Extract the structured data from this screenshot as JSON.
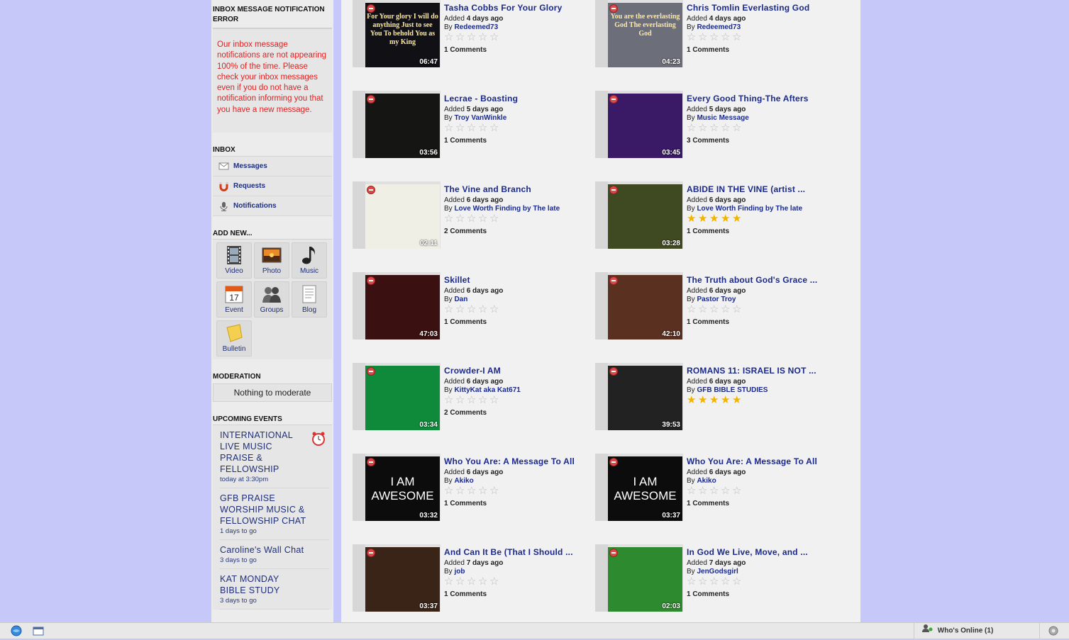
{
  "sidebar": {
    "error_title": "INBOX MESSAGE NOTIFICATION ERROR",
    "error_text": "Our inbox message notifications are not appearing 100% of the time. Please check your inbox messages even if you do not have a notification informing you that you have a new message.",
    "inbox_title": "INBOX",
    "inbox_items": [
      {
        "label": "Messages",
        "icon": "envelope-icon"
      },
      {
        "label": "Requests",
        "icon": "magnet-icon"
      },
      {
        "label": "Notifications",
        "icon": "microphone-icon"
      }
    ],
    "add_title": "ADD NEW...",
    "add_items": [
      {
        "label": "Video",
        "icon": "film-icon"
      },
      {
        "label": "Photo",
        "icon": "photo-icon"
      },
      {
        "label": "Music",
        "icon": "music-note-icon"
      },
      {
        "label": "Event",
        "icon": "calendar-icon"
      },
      {
        "label": "Groups",
        "icon": "groups-icon"
      },
      {
        "label": "Blog",
        "icon": "blog-icon"
      },
      {
        "label": "Bulletin",
        "icon": "sticky-note-icon"
      }
    ],
    "moderation_title": "MODERATION",
    "moderation_text": "Nothing to moderate",
    "events_title": "UPCOMING EVENTS",
    "events": [
      {
        "title": "INTERNATIONAL LIVE MUSIC PRAISE & FELLOWSHIP",
        "when": "today at 3:30pm"
      },
      {
        "title": "GFB PRAISE WORSHIP MUSIC & FELLOWSHIP CHAT",
        "when": "1 days to go"
      },
      {
        "title": "Caroline's Wall Chat",
        "when": "3 days to go"
      },
      {
        "title": "KAT MONDAY BIBLE STUDY",
        "when": "3 days to go"
      }
    ]
  },
  "videos": [
    {
      "title": "Tasha Cobbs For Your Glory",
      "added": "4 days ago",
      "by": "Redeemed73",
      "rating": 0,
      "comments": "1 Comments",
      "duration": "06:47",
      "thumb_color": "#101015",
      "thumb_text": "For Your glory I will do anything Just to see You To behold You as my King"
    },
    {
      "title": "Chris Tomlin Everlasting God",
      "added": "4 days ago",
      "by": "Redeemed73",
      "rating": 0,
      "comments": "1 Comments",
      "duration": "04:23",
      "thumb_color": "#6c6e7a",
      "thumb_text": "You are the everlasting God The everlasting God"
    },
    {
      "title": "Lecrae - Boasting",
      "added": "5 days ago",
      "by": "Troy VanWinkle",
      "rating": 0,
      "comments": "1 Comments",
      "duration": "03:56",
      "thumb_color": "#151514",
      "thumb_text": ""
    },
    {
      "title": "Every Good Thing-The Afters",
      "added": "5 days ago",
      "by": "Music Message",
      "rating": 0,
      "comments": "3 Comments",
      "duration": "03:45",
      "thumb_color": "#3a1a66",
      "thumb_text": ""
    },
    {
      "title": "The Vine and Branch",
      "added": "6 days ago",
      "by": "Love Worth Finding by The late",
      "rating": 0,
      "comments": "2 Comments",
      "duration": "02:11",
      "thumb_color": "#efefe6",
      "thumb_text": ""
    },
    {
      "title": "ABIDE IN THE VINE (artist ...",
      "added": "6 days ago",
      "by": "Love Worth Finding by The late",
      "rating": 5,
      "comments": "1 Comments",
      "duration": "03:28",
      "thumb_color": "#3f4a22",
      "thumb_text": ""
    },
    {
      "title": "Skillet",
      "added": "6 days ago",
      "by": "Dan",
      "rating": 0,
      "comments": "1 Comments",
      "duration": "47:03",
      "thumb_color": "#3a1010",
      "thumb_text": ""
    },
    {
      "title": "The Truth about God's Grace ...",
      "added": "6 days ago",
      "by": "Pastor Troy",
      "rating": 0,
      "comments": "1 Comments",
      "duration": "42:10",
      "thumb_color": "#5a3020",
      "thumb_text": ""
    },
    {
      "title": "Crowder-I AM",
      "added": "6 days ago",
      "by": "KittyKat aka Kat671",
      "rating": 0,
      "comments": "2 Comments",
      "duration": "03:34",
      "thumb_color": "#0f8a3a",
      "thumb_text": ""
    },
    {
      "title": "ROMANS 11: ISRAEL IS NOT ...",
      "added": "6 days ago",
      "by": "GFB BIBLE STUDIES",
      "rating": 5,
      "comments": "",
      "duration": "39:53",
      "thumb_color": "#222222",
      "thumb_text": ""
    },
    {
      "title": "Who You Are: A Message To All",
      "added": "6 days ago",
      "by": "Akiko",
      "rating": 0,
      "comments": "1 Comments",
      "duration": "03:32",
      "thumb_color": "#0c0c0c",
      "thumb_text": "I AM AWESOME"
    },
    {
      "title": "Who You Are: A Message To All",
      "added": "6 days ago",
      "by": "Akiko",
      "rating": 0,
      "comments": "1 Comments",
      "duration": "03:37",
      "thumb_color": "#0c0c0c",
      "thumb_text": "I AM AWESOME"
    },
    {
      "title": "And Can It Be (That I Should ...",
      "added": "7 days ago",
      "by": "job",
      "rating": 0,
      "comments": "1 Comments",
      "duration": "03:37",
      "thumb_color": "#3a2418",
      "thumb_text": ""
    },
    {
      "title": "In God We Live, Move, and ...",
      "added": "7 days ago",
      "by": "JenGodsgirl",
      "rating": 0,
      "comments": "1 Comments",
      "duration": "02:03",
      "thumb_color": "#2e8a2e",
      "thumb_text": ""
    }
  ],
  "labels": {
    "added": "Added",
    "by": "By"
  },
  "taskbar": {
    "who_online": "Who's Online (1)"
  }
}
